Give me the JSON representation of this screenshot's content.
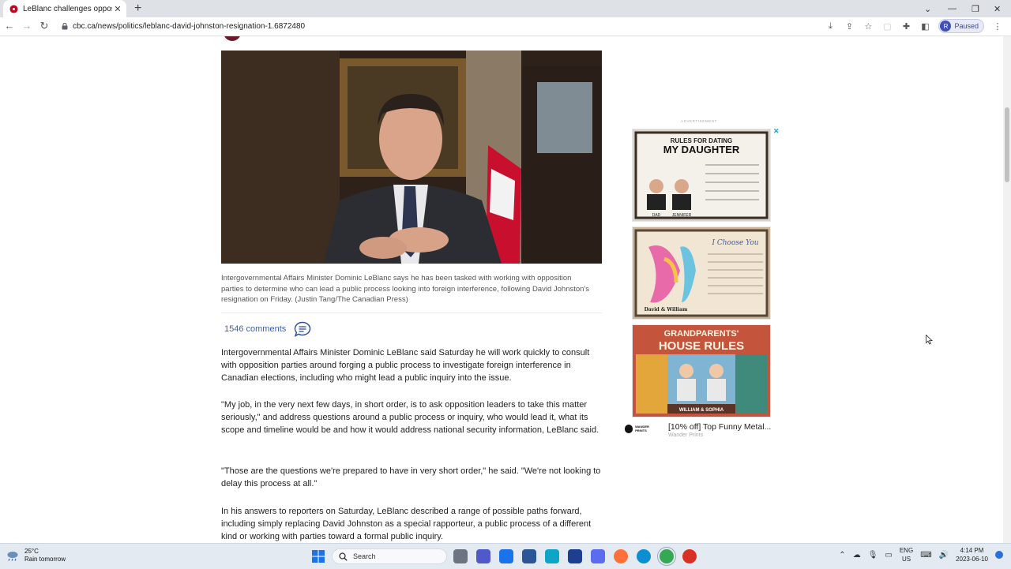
{
  "browser": {
    "tab_title": "LeBlanc challenges opposition to",
    "tab_close": "✕",
    "new_tab": "+",
    "url": "cbc.ca/news/politics/leblanc-david-johnston-resignation-1.6872480",
    "profile_initial": "R",
    "profile_status": "Paused",
    "nav": {
      "back": "←",
      "forward": "→",
      "reload": "↻"
    },
    "window": {
      "minimize": "—",
      "restore": "❐",
      "close": "✕",
      "tab_search": "⌄"
    }
  },
  "article": {
    "photo_caption": "Intergovernmental Affairs Minister Dominic LeBlanc says he has been tasked with working with opposition parties to determine who can lead a public process looking into foreign interference, following David Johnston's resignation on Friday. (Justin Tang/The Canadian Press)",
    "comments_count": "1546 comments",
    "paragraphs": [
      "Intergovernmental Affairs Minister Dominic LeBlanc said Saturday he will work quickly to consult with opposition parties around forging a public process to investigate foreign interference in Canadian elections, including who might lead a public inquiry into the issue.",
      "\"My job, in the very next few days, in short order, is to ask opposition leaders to take this matter seriously,\" and address questions around a public process or inquiry, who would lead it, what its scope and timeline would be and how it would address national security information, LeBlanc said.",
      "\"Those are the questions we're prepared to have in very short order,\" he said. \"We're not looking to delay this process at all.\"",
      "In his answers to reporters on Saturday, LeBlanc described a range of possible paths forward, including simply replacing David Johnston as a special rapporteur, a public process of a different kind or working with parties toward a formal public inquiry."
    ]
  },
  "ad": {
    "label": "ADVERTISEMENT",
    "images": [
      {
        "line1": "RULES FOR DATING",
        "line2": "MY DAUGHTER",
        "names": [
          "DAD",
          "JENNIFER"
        ]
      },
      {
        "script": "I Choose You",
        "names": "David & William"
      },
      {
        "line1": "GRANDPARENTS'",
        "line2": "HOUSE RULES",
        "names": "WILLIAM & SOPHIA"
      }
    ],
    "logo_text": "WANDER PRINTS",
    "headline": "[10% off] Top Funny Metal...",
    "advertiser": "Wander Prints"
  },
  "taskbar": {
    "temperature": "25°C",
    "weather_text": "Rain tomorrow",
    "search_label": "Search",
    "lang_line1": "ENG",
    "lang_line2": "US",
    "time": "4:14 PM",
    "date": "2023-06-10"
  },
  "colors": {
    "link": "#3f5fa8",
    "tab_bar": "#dee1e6",
    "taskbar": "#e4eaf2",
    "ad_accent": "#00aecd"
  }
}
